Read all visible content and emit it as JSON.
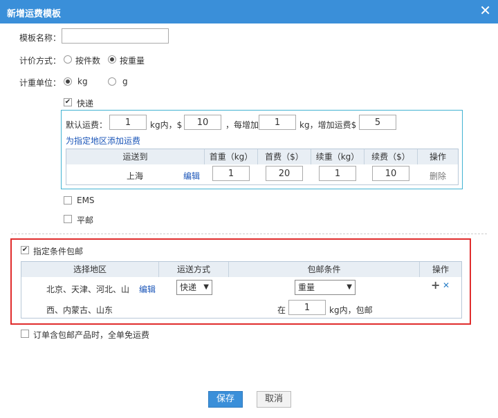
{
  "dialog": {
    "title": "新增运费模板",
    "close_glyph": "✕"
  },
  "form": {
    "name_label": "模板名称：",
    "name_value": "",
    "pricing_label": "计价方式：",
    "pricing_options": [
      "按件数",
      "按重量"
    ],
    "unit_label": "计重单位：",
    "unit_options": [
      "kg",
      "g"
    ]
  },
  "express": {
    "label": "快递",
    "default_prefix": "默认运费：",
    "first_weight": "1",
    "first_unit": "kg内，$",
    "first_fee": "10",
    "each_add_label": "，每增加",
    "add_weight": "1",
    "add_unit": "kg，增加运费$",
    "add_fee": "5",
    "add_region_link": "为指定地区添加运费",
    "table_headers": [
      "运送到",
      "首重（kg）",
      "首费（$）",
      "续重（kg）",
      "续费（$）",
      "操作"
    ],
    "row": {
      "region": "上海",
      "edit": "编辑",
      "first_weight": "1",
      "first_fee": "20",
      "add_weight": "1",
      "add_fee": "10",
      "delete": "删除"
    }
  },
  "ems_label": "EMS",
  "post_label": "平邮",
  "free_shipping": {
    "label": "指定条件包邮",
    "headers": [
      "选择地区",
      "运送方式",
      "包邮条件",
      "操作"
    ],
    "row": {
      "region_line1": "北京、天津、河北、山",
      "region_line2": "西、内蒙古、山东",
      "edit": "编辑",
      "method": "快递",
      "condition": "重量",
      "cond_prefix": "在",
      "cond_value": "1",
      "cond_suffix": "kg内，包邮",
      "add_glyph": "+",
      "remove_glyph": "✕"
    }
  },
  "order_free_label": "订单含包邮产品时，全单免运费",
  "buttons": {
    "save": "保存",
    "cancel": "取消"
  },
  "colors": {
    "title_bar": "#3a8fd9",
    "highlight_border": "#e02b2b",
    "express_frame": "#41b2d2",
    "link": "#1a55b8"
  }
}
